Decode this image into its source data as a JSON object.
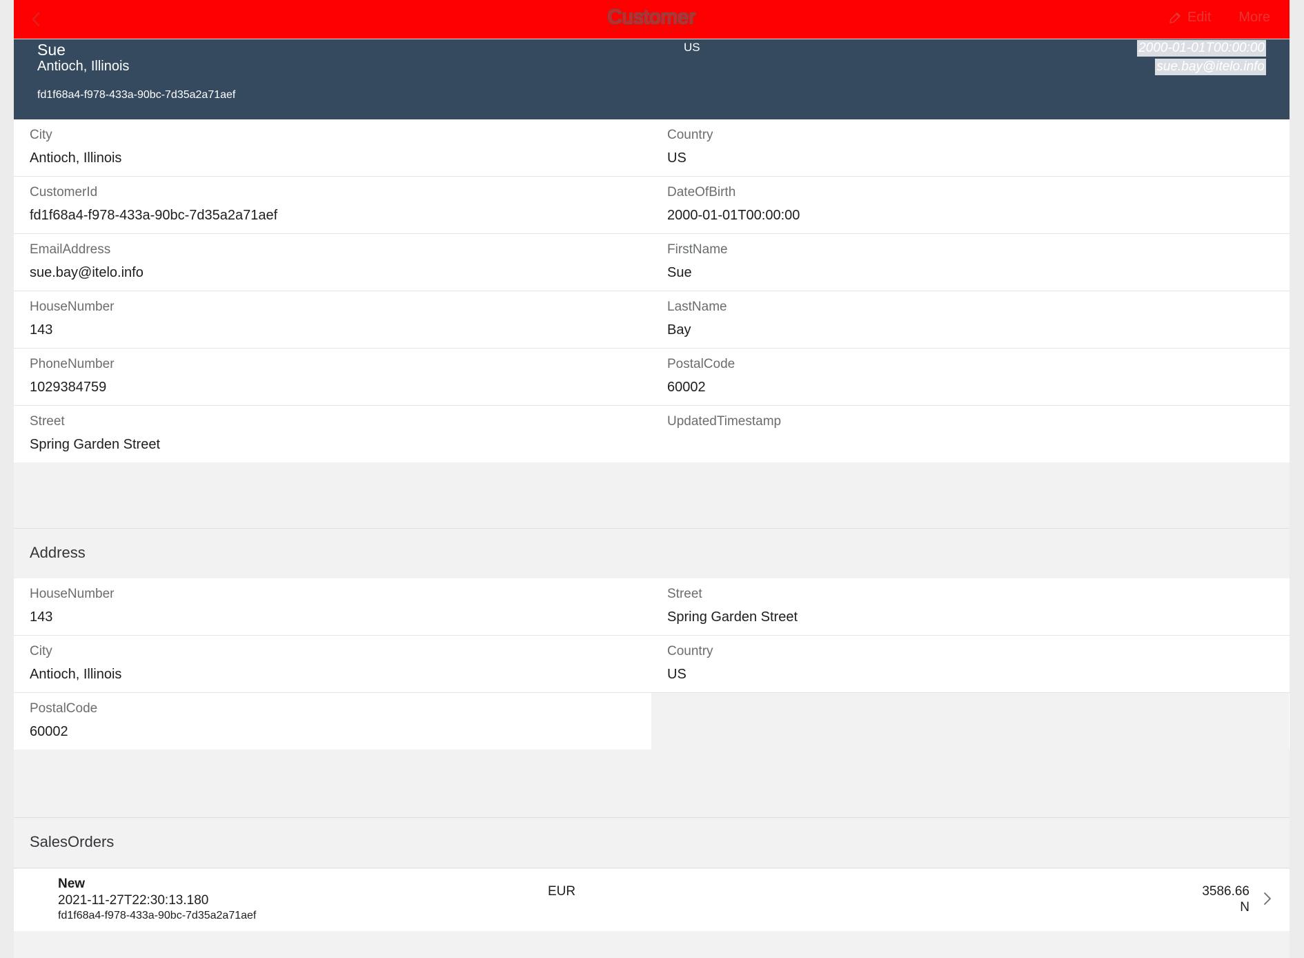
{
  "nav": {
    "title": "Customer",
    "edit_label": "Edit",
    "more_label": "More"
  },
  "header": {
    "title": "Sue",
    "subtitle": "Antioch, Illinois",
    "id": "fd1f68a4-f978-433a-90bc-7d35a2a71aef",
    "country": "US",
    "date": "2000-01-01T00:00:00",
    "email": "sue.bay@itelo.info"
  },
  "customer": {
    "rows": [
      [
        {
          "label": "City",
          "value": "Antioch, Illinois"
        },
        {
          "label": "Country",
          "value": "US"
        }
      ],
      [
        {
          "label": "CustomerId",
          "value": "fd1f68a4-f978-433a-90bc-7d35a2a71aef"
        },
        {
          "label": "DateOfBirth",
          "value": "2000-01-01T00:00:00"
        }
      ],
      [
        {
          "label": "EmailAddress",
          "value": "sue.bay@itelo.info"
        },
        {
          "label": "FirstName",
          "value": "Sue"
        }
      ],
      [
        {
          "label": "HouseNumber",
          "value": "143"
        },
        {
          "label": "LastName",
          "value": "Bay"
        }
      ],
      [
        {
          "label": "PhoneNumber",
          "value": "1029384759"
        },
        {
          "label": "PostalCode",
          "value": "60002"
        }
      ],
      [
        {
          "label": "Street",
          "value": "Spring Garden Street"
        },
        {
          "label": "UpdatedTimestamp",
          "value": ""
        }
      ]
    ]
  },
  "address": {
    "title": "Address",
    "rows": [
      [
        {
          "label": "HouseNumber",
          "value": "143"
        },
        {
          "label": "Street",
          "value": "Spring Garden Street"
        }
      ],
      [
        {
          "label": "City",
          "value": "Antioch, Illinois"
        },
        {
          "label": "Country",
          "value": "US"
        }
      ],
      [
        {
          "label": "PostalCode",
          "value": "60002"
        }
      ]
    ]
  },
  "sales_orders": {
    "title": "SalesOrders",
    "items": [
      {
        "status": "New",
        "created": "2021-11-27T22:30:13.180",
        "customer_id": "fd1f68a4-f978-433a-90bc-7d35a2a71aef",
        "currency": "EUR",
        "amount": "3586.66",
        "flag": "N"
      }
    ]
  },
  "colors": {
    "navbar": "#ff0000",
    "header": "#354a5f",
    "background": "#f2f2f2"
  },
  "icons": [
    "back-icon",
    "edit-icon",
    "chevron-right-icon"
  ]
}
